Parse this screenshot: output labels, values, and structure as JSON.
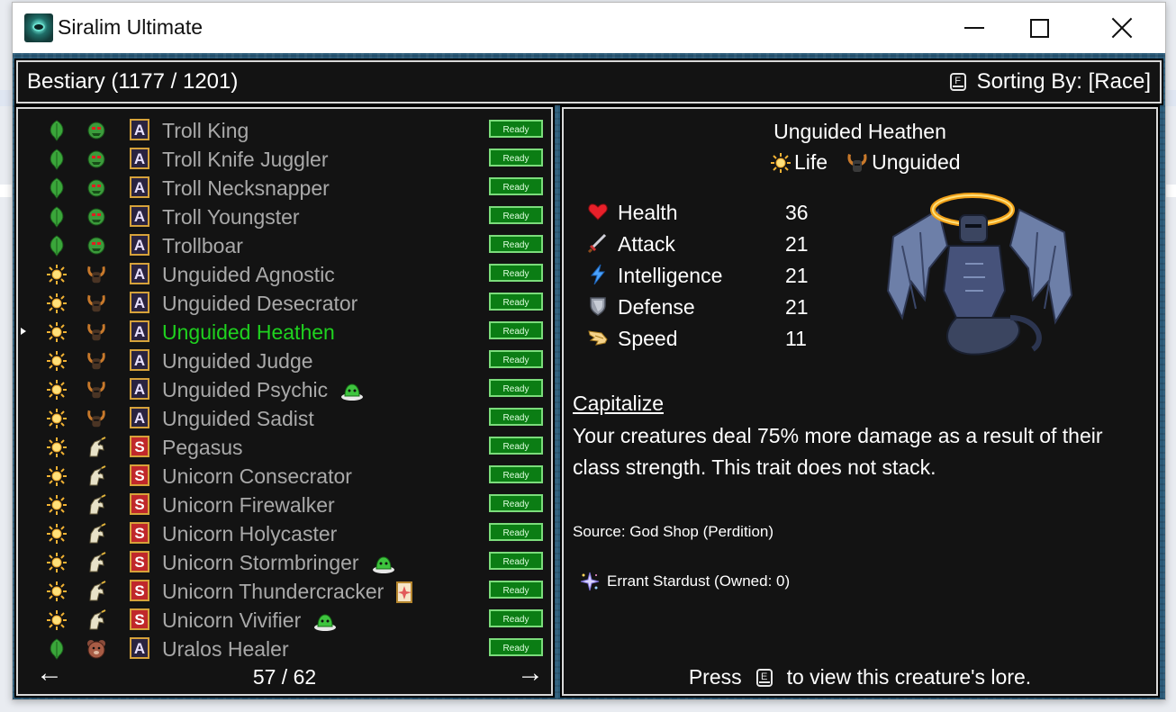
{
  "window": {
    "title": "Siralim Ultimate",
    "controls": {
      "minimize": "minimize",
      "maximize": "maximize",
      "close": "close"
    }
  },
  "header": {
    "title": "Bestiary (1177 / 1201)",
    "sort_key": "F",
    "sort_label": "Sorting By: [Race]"
  },
  "list": {
    "ready_label": "Ready",
    "selected_index": 7,
    "items": [
      {
        "name": "Troll King",
        "class": "nature",
        "race": "troll",
        "type": "A",
        "extra": ""
      },
      {
        "name": "Troll Knife Juggler",
        "class": "nature",
        "race": "troll",
        "type": "A",
        "extra": ""
      },
      {
        "name": "Troll Necksnapper",
        "class": "nature",
        "race": "troll",
        "type": "A",
        "extra": ""
      },
      {
        "name": "Troll Youngster",
        "class": "nature",
        "race": "troll",
        "type": "A",
        "extra": ""
      },
      {
        "name": "Trollboar",
        "class": "nature",
        "race": "troll",
        "type": "A",
        "extra": ""
      },
      {
        "name": "Unguided Agnostic",
        "class": "life",
        "race": "unguided",
        "type": "A",
        "extra": ""
      },
      {
        "name": "Unguided Desecrator",
        "class": "life",
        "race": "unguided",
        "type": "A",
        "extra": ""
      },
      {
        "name": "Unguided Heathen",
        "class": "life",
        "race": "unguided",
        "type": "A",
        "extra": ""
      },
      {
        "name": "Unguided Judge",
        "class": "life",
        "race": "unguided",
        "type": "A",
        "extra": ""
      },
      {
        "name": "Unguided Psychic",
        "class": "life",
        "race": "unguided",
        "type": "A",
        "extra": "slime"
      },
      {
        "name": "Unguided Sadist",
        "class": "life",
        "race": "unguided",
        "type": "A",
        "extra": ""
      },
      {
        "name": "Pegasus",
        "class": "life",
        "race": "unicorn",
        "type": "S",
        "extra": ""
      },
      {
        "name": "Unicorn Consecrator",
        "class": "life",
        "race": "unicorn",
        "type": "S",
        "extra": ""
      },
      {
        "name": "Unicorn Firewalker",
        "class": "life",
        "race": "unicorn",
        "type": "S",
        "extra": ""
      },
      {
        "name": "Unicorn Holycaster",
        "class": "life",
        "race": "unicorn",
        "type": "S",
        "extra": ""
      },
      {
        "name": "Unicorn Stormbringer",
        "class": "life",
        "race": "unicorn",
        "type": "S",
        "extra": "slime"
      },
      {
        "name": "Unicorn Thundercracker",
        "class": "life",
        "race": "unicorn",
        "type": "S",
        "extra": "card"
      },
      {
        "name": "Unicorn Vivifier",
        "class": "life",
        "race": "unicorn",
        "type": "S",
        "extra": "slime"
      },
      {
        "name": "Uralos Healer",
        "class": "nature",
        "race": "uralos",
        "type": "A",
        "extra": ""
      }
    ],
    "page": "57 / 62"
  },
  "detail": {
    "name": "Unguided Heathen",
    "class_label": "Life",
    "race_label": "Unguided",
    "stats": [
      {
        "label": "Health",
        "value": "36",
        "icon": "heart-icon"
      },
      {
        "label": "Attack",
        "value": "21",
        "icon": "sword-icon"
      },
      {
        "label": "Intelligence",
        "value": "21",
        "icon": "lightning-icon"
      },
      {
        "label": "Defense",
        "value": "21",
        "icon": "shield-icon"
      },
      {
        "label": "Speed",
        "value": "11",
        "icon": "wing-icon"
      }
    ],
    "trait_name": "Capitalize",
    "trait_desc": "Your creatures deal 75% more damage as a result of their class strength. This trait does not stack.",
    "source": "Source: God Shop (Perdition)",
    "material": "Errant Stardust (Owned: 0)",
    "lore_press": "Press",
    "lore_key": "E",
    "lore_rest": "to view this creature's lore."
  },
  "colors": {
    "panel_bg": "#131313",
    "list_text": "#a9a9a9",
    "selected_text": "#1fd21f",
    "ready_bg": "#0b7d14"
  }
}
